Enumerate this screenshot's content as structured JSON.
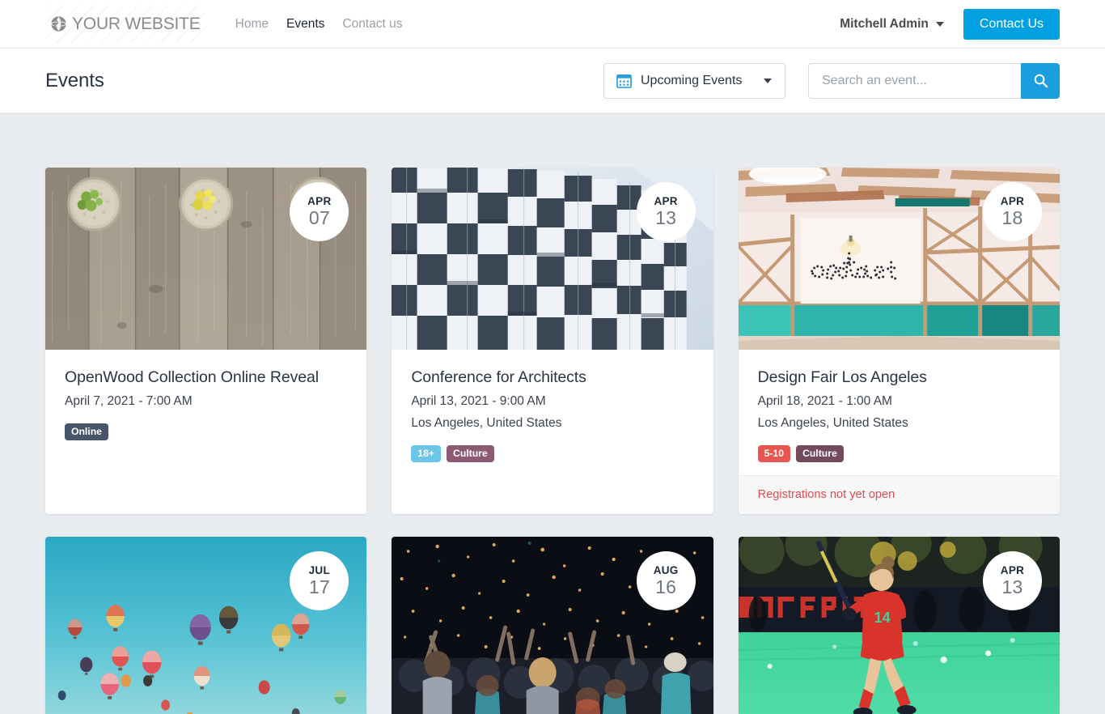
{
  "navbar": {
    "brand_text": "YOUR WEBSITE",
    "brand_icon": "globe-icon",
    "links": [
      {
        "label": "Home",
        "active": false
      },
      {
        "label": "Events",
        "active": true
      },
      {
        "label": "Contact us",
        "active": false
      }
    ],
    "user_name": "Mitchell Admin",
    "user_caret_icon": "chevron-down-icon",
    "contact_button": "Contact Us",
    "accent_color": "#00a0e1"
  },
  "subheader": {
    "page_title": "Events",
    "filter": {
      "icon": "calendar-icon",
      "selected": "Upcoming Events",
      "caret_icon": "chevron-down-icon"
    },
    "search": {
      "placeholder": "Search an event...",
      "value": "",
      "button_icon": "search-icon",
      "button_color": "#1a9ee0"
    }
  },
  "events": [
    {
      "date_month": "APR",
      "date_day": "07",
      "title": "OpenWood Collection Online Reveal",
      "datetime": "April 7, 2021 - 7:00 AM",
      "location": "",
      "tags": [
        {
          "label": "Online",
          "color": "#475569"
        }
      ],
      "footer": "",
      "image": "wooden-planks-with-succulent-bowls"
    },
    {
      "date_month": "APR",
      "date_day": "13",
      "title": "Conference for Architects",
      "datetime": "April 13, 2021 - 9:00 AM",
      "location": "Los Angeles, United States",
      "tags": [
        {
          "label": "18+",
          "color": "#6bc5e8"
        },
        {
          "label": "Culture",
          "color": "#8c5a72"
        }
      ],
      "footer": "",
      "image": "checkered-building-facade"
    },
    {
      "date_month": "APR",
      "date_day": "18",
      "title": "Design Fair Los Angeles",
      "datetime": "April 18, 2021 - 1:00 AM",
      "location": "Los Angeles, United States",
      "tags": [
        {
          "label": "5-10",
          "color": "#e8564f"
        },
        {
          "label": "Culture",
          "color": "#714a5e"
        }
      ],
      "footer": "Registrations not yet open",
      "image": "create-sign-interior"
    },
    {
      "date_month": "JUL",
      "date_day": "17",
      "title": "",
      "datetime": "",
      "location": "",
      "tags": [],
      "footer": "",
      "image": "hot-air-balloons-sky"
    },
    {
      "date_month": "AUG",
      "date_day": "16",
      "title": "",
      "datetime": "",
      "location": "",
      "tags": [],
      "footer": "",
      "image": "concert-crowd-lights"
    },
    {
      "date_month": "APR",
      "date_day": "13",
      "title": "",
      "datetime": "",
      "location": "",
      "tags": [],
      "footer": "",
      "image": "field-hockey-player"
    }
  ]
}
